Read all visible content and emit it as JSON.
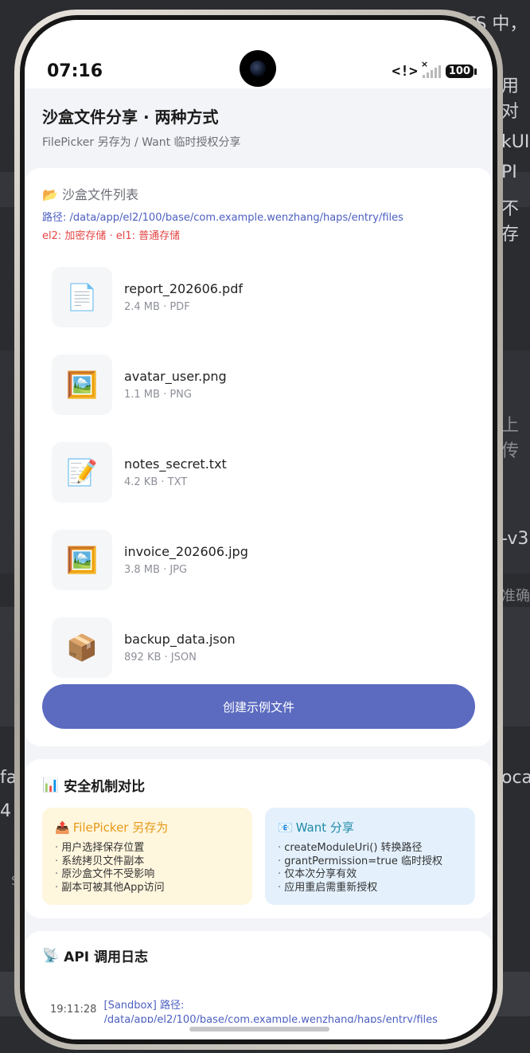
{
  "status": {
    "time": "07:16",
    "battery": "100",
    "net_icon": "<!>"
  },
  "background": {
    "t1": "TS 中，",
    "t2": "用对",
    "t3": "kUI",
    "t4": "PI",
    "t5": "不存",
    "t6": "上传",
    "t7": "-v3",
    "t8": "准确",
    "t9": "fa",
    "t10": "4",
    "t11": "oca",
    "t12": "S"
  },
  "header": {
    "title": "沙盒文件分享 · 两种方式",
    "subtitle": "FilePicker 另存为 / Want 临时授权分享"
  },
  "sandbox": {
    "title_icon": "📂",
    "title": "沙盒文件列表",
    "path": "路径: /data/app/el2/100/base/com.example.wenzhang/haps/entry/files",
    "storage_note": "el2: 加密存储 · el1: 普通存储",
    "files": [
      {
        "icon": "📄",
        "name": "report_202606.pdf",
        "meta": "2.4 MB · PDF"
      },
      {
        "icon": "🖼️",
        "name": "avatar_user.png",
        "meta": "1.1 MB · PNG"
      },
      {
        "icon": "📝",
        "name": "notes_secret.txt",
        "meta": "4.2 KB · TXT"
      },
      {
        "icon": "🖼️",
        "name": "invoice_202606.jpg",
        "meta": "3.8 MB · JPG"
      },
      {
        "icon": "📦",
        "name": "backup_data.json",
        "meta": "892 KB · JSON"
      }
    ],
    "create_button": "创建示例文件"
  },
  "security": {
    "title_icon": "📊",
    "title": "安全机制对比",
    "filepicker": {
      "icon": "📤",
      "title": "FilePicker 另存为",
      "items": [
        "用户选择保存位置",
        "系统拷贝文件副本",
        "原沙盒文件不受影响",
        "副本可被其他App访问"
      ]
    },
    "want": {
      "icon": "📧",
      "title": "Want 分享",
      "items": [
        "createModuleUri() 转换路径",
        "grantPermission=true 临时授权",
        "仅本次分享有效",
        "应用重启需重新授权"
      ]
    }
  },
  "log": {
    "title_icon": "📡",
    "title": "API 调用日志",
    "entries": [
      {
        "time": "19:11:28",
        "message": "[Sandbox] 路径: /data/app/el2/100/base/com.example.wenzhang/haps/entry/files"
      }
    ]
  }
}
